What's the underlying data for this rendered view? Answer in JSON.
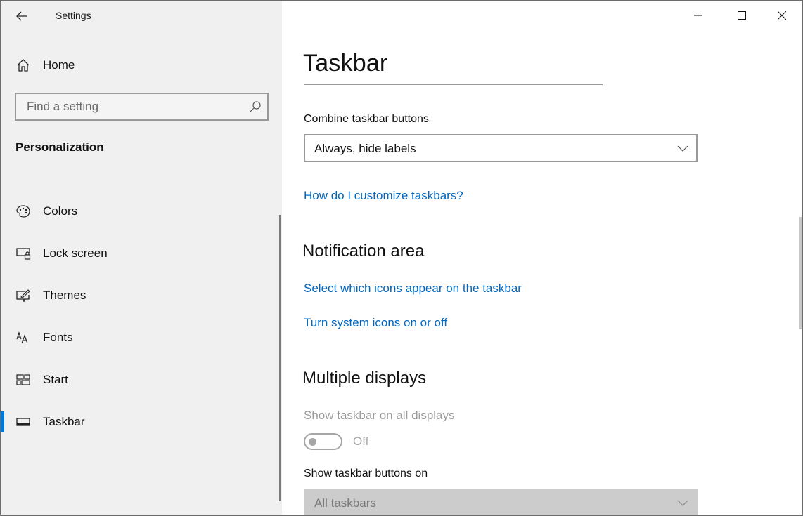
{
  "window": {
    "title": "Settings",
    "controls": {
      "minimize": "minimize-icon",
      "maximize": "maximize-icon",
      "close": "close-icon"
    }
  },
  "sidebar": {
    "back_icon": "back-arrow-icon",
    "home": {
      "label": "Home",
      "icon": "home-icon"
    },
    "search": {
      "placeholder": "Find a setting",
      "value": "",
      "icon": "search-icon"
    },
    "section_title": "Personalization",
    "items": [
      {
        "label": "Colors",
        "icon": "palette-icon",
        "selected": false
      },
      {
        "label": "Lock screen",
        "icon": "lock-screen-icon",
        "selected": false
      },
      {
        "label": "Themes",
        "icon": "themes-icon",
        "selected": false
      },
      {
        "label": "Fonts",
        "icon": "fonts-icon",
        "selected": false
      },
      {
        "label": "Start",
        "icon": "start-icon",
        "selected": false
      },
      {
        "label": "Taskbar",
        "icon": "taskbar-icon",
        "selected": true
      }
    ],
    "accent_color": "#0078d7"
  },
  "main": {
    "title": "Taskbar",
    "combine": {
      "label": "Combine taskbar buttons",
      "value": "Always, hide labels"
    },
    "help_link": "How do I customize taskbars?",
    "notification_area": {
      "heading": "Notification area",
      "links": [
        "Select which icons appear on the taskbar",
        "Turn system icons on or off"
      ]
    },
    "multiple_displays": {
      "heading": "Multiple displays",
      "show_all_label": "Show taskbar on all displays",
      "show_all_state": "Off",
      "show_all_enabled": false,
      "buttons_on_label": "Show taskbar buttons on",
      "buttons_on_value": "All taskbars"
    },
    "link_color": "#0067c0"
  }
}
